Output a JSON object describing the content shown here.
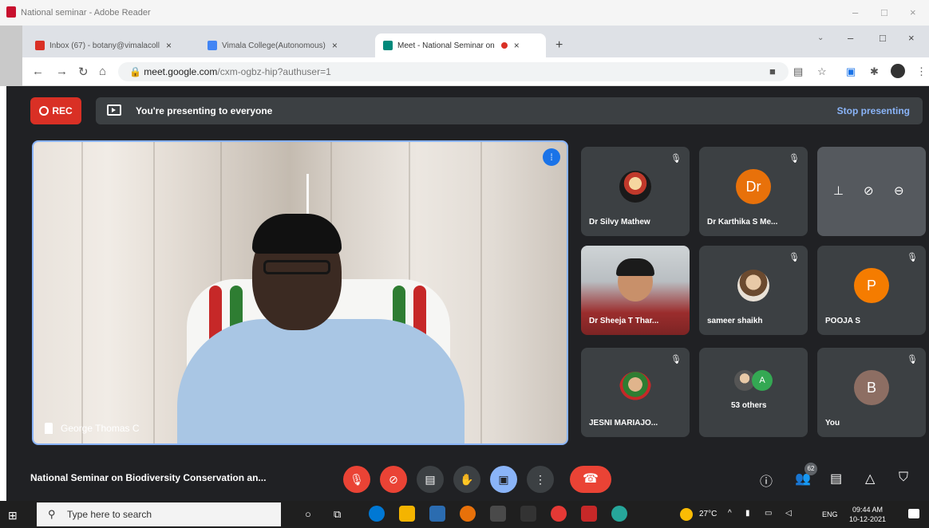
{
  "reader": {
    "title": "National seminar - Adobe Reader"
  },
  "browser": {
    "tabs": [
      {
        "label": "Inbox (67) - botany@vimalacoll",
        "fav_color": "#d93025"
      },
      {
        "label": "Vimala College(Autonomous)",
        "fav_color": "#4285f4"
      },
      {
        "label": "Meet - National Seminar on",
        "fav_color": "#00897b"
      }
    ],
    "new_tab": "+",
    "url_host": "meet.google.com",
    "url_path": "/cxm-ogbz-hip?authuser=1"
  },
  "meet": {
    "rec_label": "REC",
    "presenting_text": "You're presenting to everyone",
    "stop_presenting": "Stop presenting",
    "main_speaker": "George Thomas C",
    "participants": [
      {
        "name": "Dr Silvy Mathew",
        "type": "photo"
      },
      {
        "name": "Dr Karthika S Me...",
        "initial": "Dr",
        "color": "#e8710a"
      },
      {
        "name": "Dr Sheeja T Thar...",
        "type": "video"
      },
      {
        "name": "sameer shaikh",
        "type": "photo"
      },
      {
        "name": "POOJA S",
        "initial": "P",
        "color": "#f57c00"
      },
      {
        "name": "JESNI MARIAJO...",
        "type": "photo"
      },
      {
        "name": "53 others",
        "initial": "A",
        "color": "#34a853"
      },
      {
        "name": "You",
        "initial": "B",
        "color": "#8d6e63"
      }
    ],
    "meeting_title": "National Seminar on Biodiversity Conservation an...",
    "people_count": "62"
  },
  "taskbar": {
    "search_placeholder": "Type here to search",
    "temperature": "27°C",
    "language": "ENG",
    "time": "09:44 AM",
    "date": "10-12-2021"
  },
  "colors": {
    "meet_bg": "#202124",
    "tile_bg": "#3c4043",
    "accent": "#8ab4f8",
    "red": "#ea4335"
  }
}
